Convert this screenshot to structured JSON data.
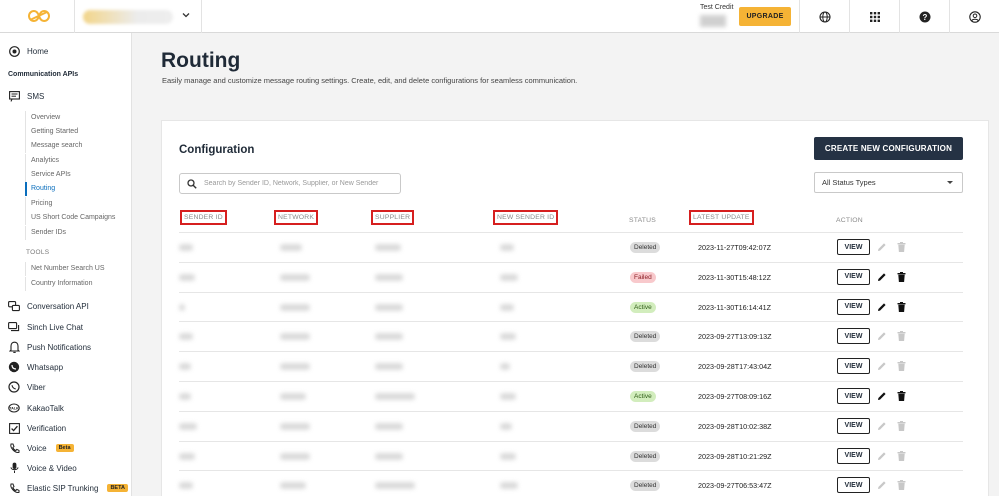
{
  "topbar": {
    "credit_label": "Test Credit",
    "upgrade_label": "UPGRADE"
  },
  "sidebar": {
    "home": "Home",
    "section_label": "Communication APIs",
    "sms": "SMS",
    "sms_items": [
      "Overview",
      "Getting Started",
      "Message search",
      "Analytics",
      "Service APIs",
      "Routing",
      "Pricing",
      "US Short Code Campaigns",
      "Sender IDs"
    ],
    "tools_label": "TOOLS",
    "tools_items": [
      "Net Number Search US",
      "Country Information"
    ],
    "nav": [
      {
        "label": "Conversation API",
        "icon": "chat-bubbles-icon"
      },
      {
        "label": "Sinch Live Chat",
        "icon": "live-chat-icon"
      },
      {
        "label": "Push Notifications",
        "icon": "bell-icon"
      },
      {
        "label": "Whatsapp",
        "icon": "whatsapp-icon"
      },
      {
        "label": "Viber",
        "icon": "viber-icon"
      },
      {
        "label": "KakaoTalk",
        "icon": "kakaotalk-icon"
      },
      {
        "label": "Verification",
        "icon": "check-square-icon"
      },
      {
        "label": "Voice",
        "icon": "phone-icon",
        "badge": "Beta"
      },
      {
        "label": "Voice & Video",
        "icon": "microphone-icon"
      },
      {
        "label": "Elastic SIP Trunking",
        "icon": "phone-icon",
        "badge": "BETA"
      }
    ]
  },
  "page": {
    "title": "Routing",
    "subtitle": "Easily manage and customize message routing settings. Create, edit, and delete configurations for seamless communication."
  },
  "config": {
    "title": "Configuration",
    "create_label": "CREATE NEW CONFIGURATION",
    "search_placeholder": "Search by Sender ID, Network, Supplier, or New Sender",
    "status_filter": "All Status Types",
    "columns": [
      "SENDER ID",
      "NETWORK",
      "SUPPLIER",
      "NEW SENDER ID",
      "STATUS",
      "LATEST UPDATE",
      "ACTION"
    ],
    "view_label": "VIEW",
    "rows": [
      {
        "status": "Deleted",
        "updated": "2023-11-27T09:42:07Z"
      },
      {
        "status": "Failed",
        "updated": "2023-11-30T15:48:12Z"
      },
      {
        "status": "Active",
        "updated": "2023-11-30T16:14:41Z"
      },
      {
        "status": "Deleted",
        "updated": "2023-09-27T13:09:13Z"
      },
      {
        "status": "Deleted",
        "updated": "2023-09-28T17:43:04Z"
      },
      {
        "status": "Active",
        "updated": "2023-09-27T08:09:16Z"
      },
      {
        "status": "Deleted",
        "updated": "2023-09-28T10:02:38Z"
      },
      {
        "status": "Deleted",
        "updated": "2023-09-28T10:21:29Z"
      },
      {
        "status": "Deleted",
        "updated": "2023-09-27T06:53:47Z"
      }
    ]
  },
  "colors": {
    "accent": "#f5b335",
    "primary_button": "#253244",
    "link_active": "#0a6ebd",
    "highlight_box": "#d61f1f"
  }
}
